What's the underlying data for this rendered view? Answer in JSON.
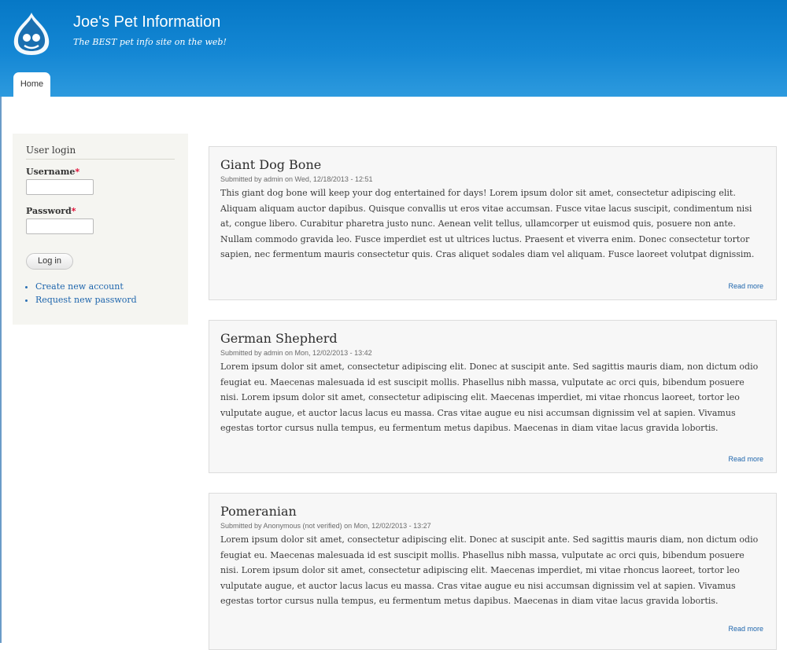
{
  "header": {
    "site_name": "Joe's Pet Information",
    "slogan": "The BEST pet info site on the web!",
    "logo_icon": "drupal-drop-icon",
    "tabs": [
      {
        "label": "Home"
      }
    ]
  },
  "sidebar": {
    "block_title": "User login",
    "username_label": "Username",
    "password_label": "Password",
    "required_marker": "*",
    "login_button": "Log in",
    "links": [
      {
        "label": "Create new account"
      },
      {
        "label": "Request new password"
      }
    ]
  },
  "articles": [
    {
      "title": "Giant Dog Bone",
      "meta": "Submitted by admin on Wed, 12/18/2013 - 12:51",
      "body": "This giant dog bone will keep your dog entertained for days! Lorem ipsum dolor sit amet, consectetur adipiscing elit. Aliquam aliquam auctor dapibus. Quisque convallis ut eros vitae accumsan. Fusce vitae lacus suscipit, condimentum nisi at, congue libero. Curabitur pharetra justo nunc. Aenean velit tellus, ullamcorper ut euismod quis, posuere non ante. Nullam commodo gravida leo. Fusce imperdiet est ut ultrices luctus. Praesent et viverra enim. Donec consectetur tortor sapien, nec fermentum mauris consectetur quis. Cras aliquet sodales diam vel aliquam. Fusce laoreet volutpat dignissim.",
      "read_more": "Read more"
    },
    {
      "title": "German Shepherd",
      "meta": "Submitted by admin on Mon, 12/02/2013 - 13:42",
      "body": "Lorem ipsum dolor sit amet, consectetur adipiscing elit. Donec at suscipit ante. Sed sagittis mauris diam, non dictum odio feugiat eu. Maecenas malesuada id est suscipit mollis. Phasellus nibh massa, vulputate ac orci quis, bibendum posuere nisi. Lorem ipsum dolor sit amet, consectetur adipiscing elit. Maecenas imperdiet, mi vitae rhoncus laoreet, tortor leo vulputate augue, et auctor lacus lacus eu massa. Cras vitae augue eu nisi accumsan dignissim vel at sapien. Vivamus egestas tortor cursus nulla tempus, eu fermentum metus dapibus. Maecenas in diam vitae lacus gravida lobortis.",
      "read_more": "Read more"
    },
    {
      "title": "Pomeranian",
      "meta": "Submitted by Anonymous (not verified) on Mon, 12/02/2013 - 13:27",
      "body": "Lorem ipsum dolor sit amet, consectetur adipiscing elit. Donec at suscipit ante. Sed sagittis mauris diam, non dictum odio feugiat eu. Maecenas malesuada id est suscipit mollis. Phasellus nibh massa, vulputate ac orci quis, bibendum posuere nisi. Lorem ipsum dolor sit amet, consectetur adipiscing elit. Maecenas imperdiet, mi vitae rhoncus laoreet, tortor leo vulputate augue, et auctor lacus lacus eu massa. Cras vitae augue eu nisi accumsan dignissim vel at sapien. Vivamus egestas tortor cursus nulla tempus, eu fermentum metus dapibus. Maecenas in diam vitae lacus gravida lobortis.",
      "read_more": "Read more"
    }
  ],
  "colors": {
    "header_top": "#0678c6",
    "header_bottom": "#2d9ade",
    "link": "#1f66ad",
    "required": "#e0002b"
  }
}
